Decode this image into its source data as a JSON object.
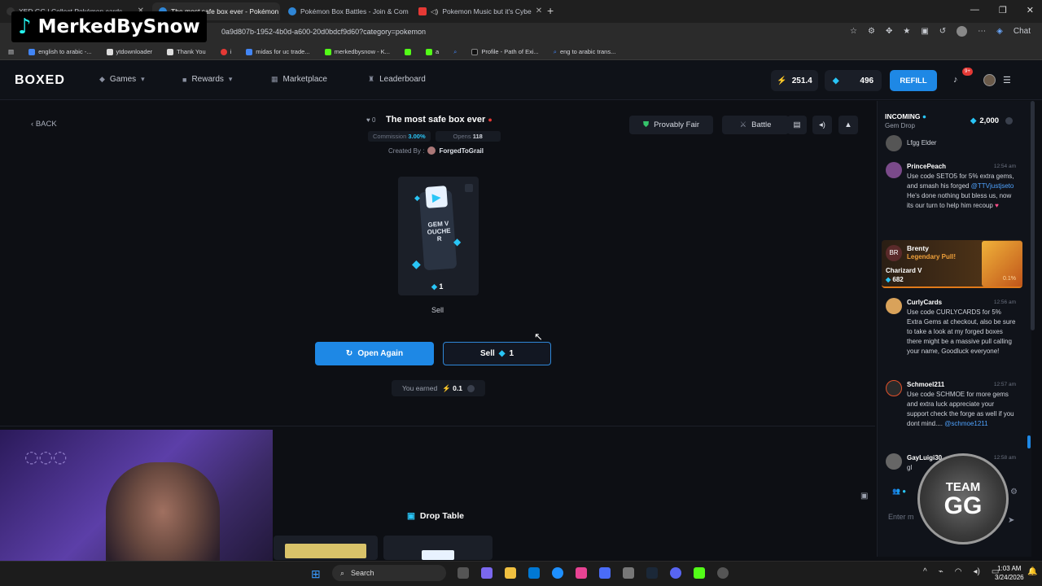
{
  "browser": {
    "tabs": [
      {
        "title": "XED.GG | Collect Pokémon cards",
        "active": false
      },
      {
        "title": "The most safe box ever - Pokémon",
        "active": true
      },
      {
        "title": "Pokémon Box Battles - Join & Com",
        "active": false
      },
      {
        "title": "Pokemon Music but it's Cybe",
        "active": false
      }
    ],
    "url": "0a9d807b-1952-4b0d-a600-20d0bdcf9d60?category=pokemon",
    "chat_label": "Chat",
    "bookmarks": [
      "english to arabic -...",
      "ytdownloader",
      "Thank You",
      "i",
      "midas for uc trade...",
      "merkedbysnow - K...",
      "",
      "a",
      "",
      "Profile - Path of Exi...",
      "eng to arabic trans..."
    ]
  },
  "watermark": "MerkedBySnow",
  "site": {
    "logo": "BOXED",
    "nav": {
      "games": "Games",
      "rewards": "Rewards",
      "marketplace": "Marketplace",
      "leaderboard": "Leaderboard"
    },
    "balance": "251.4",
    "gems": "496",
    "refill": "REFILL",
    "notif_badge": "9+"
  },
  "box": {
    "back": "BACK",
    "count": "0",
    "title": "The most safe box ever",
    "commission_label": "Commission",
    "commission_value": "3.00%",
    "opens_label": "Opens",
    "opens_value": "118",
    "created_by_label": "Created By :",
    "creator": "ForgedToGrail",
    "provably_fair": "Provably Fair",
    "battle": "Battle",
    "item_value": "1",
    "voucher_text": "GEM VOUCHER",
    "sell_label": "Sell",
    "open_again": "Open Again",
    "sell_button": "Sell",
    "sell_value": "1",
    "earned_label": "You earned",
    "earned_value": "0.1",
    "drop_table": "Drop Table"
  },
  "chat": {
    "header": "INCOMING",
    "sub": "Gem Drop",
    "gem_drop": "2,000",
    "messages": [
      {
        "name": "",
        "time": "",
        "text": "Lfgg Elder"
      },
      {
        "name": "PrincePeach",
        "time": "12:54 am",
        "text": "Use code SETO5 for 5% extra gems, and smash his forged",
        "mention": "@TTVjustjseto",
        "after": "He's done nothing but bless us, now its our turn to help him recoup"
      },
      {
        "name": "CurlyCards",
        "time": "12:56 am",
        "text": "Use code CURLYCARDS for 5% Extra Gems at checkout, also be sure to take a look at my forged boxes there might be a massive pull calling your name, Goodluck everyone!"
      },
      {
        "name": "Schmoel211",
        "time": "12:57 am",
        "text": "Use code SCHMOE for more gems and extra luck appreciate your support check the forge as well if you dont mind....",
        "mention": "@schmoe1211"
      },
      {
        "name": "GayLuigi30",
        "time": "12:58 am",
        "text": "gl"
      }
    ],
    "pull": {
      "initials": "BR",
      "user": "Brenty",
      "tag": "Legendary Pull!",
      "card": "Charizard V",
      "value": "682",
      "pct": "0.1%"
    },
    "input_placeholder": "Enter m"
  },
  "team_badge": {
    "line1": "TEAM",
    "line2": "GG"
  },
  "taskbar": {
    "search": "Search",
    "time": "1:03 AM",
    "date": "3/24/2026"
  },
  "colors": {
    "accent": "#1e88e5",
    "gem": "#29c5f6",
    "legendary": "#e07a1a"
  }
}
